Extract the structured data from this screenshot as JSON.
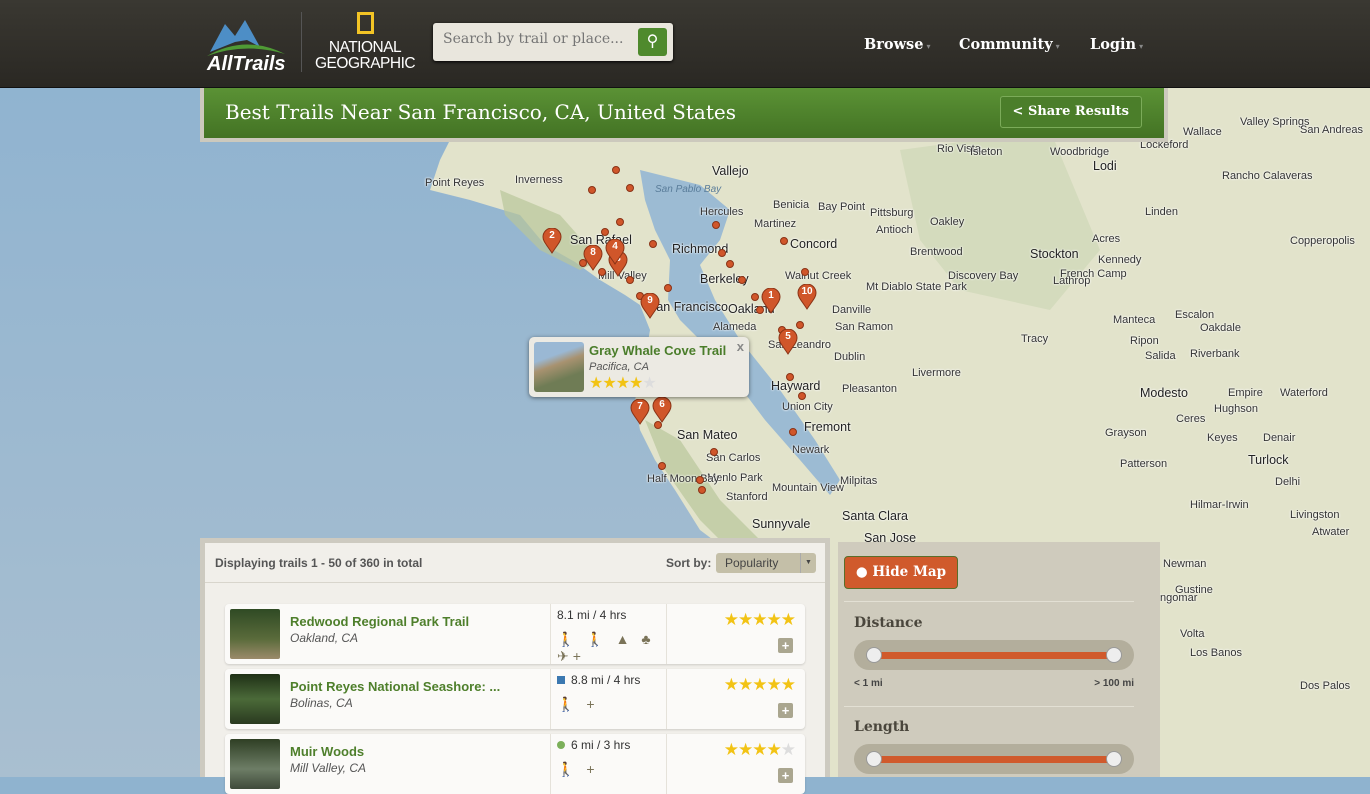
{
  "header": {
    "brand": "AllTrails",
    "partner": "NATIONAL GEOGRAPHIC",
    "search_placeholder": "Search by trail or place...",
    "nav": [
      "Browse",
      "Community",
      "Login"
    ]
  },
  "title": {
    "text": "Best Trails Near San Francisco, CA, United States",
    "share": "Share Results"
  },
  "map": {
    "labels": [
      "Point Reyes",
      "Inverness",
      "Vallejo",
      "San Pablo Bay",
      "Hercules",
      "Benicia",
      "Martinez",
      "Bay Point",
      "Pittsburg",
      "Antioch",
      "Oakley",
      "Brentwood",
      "Concord",
      "Richmond",
      "San Rafael",
      "Mill Valley",
      "Berkeley",
      "Walnut Creek",
      "Oakland",
      "San Francisco",
      "Alameda",
      "Danville",
      "San Ramon",
      "San Leandro",
      "Dublin",
      "Pleasanton",
      "Hayward",
      "Union City",
      "Fremont",
      "Livermore",
      "Tracy",
      "Stockton",
      "Lodi",
      "Manteca",
      "Modesto",
      "San Mateo",
      "San Carlos",
      "Menlo Park",
      "Half Moon Bay",
      "Stanford",
      "Mountain View",
      "Milpitas",
      "Santa Clara",
      "Sunnyvale",
      "San Jose",
      "Newark",
      "Turlock",
      "Los Banos",
      "Patterson",
      "Ceres",
      "Rio Vista",
      "Discovery Bay",
      "Ripon",
      "Salida",
      "Riverbank",
      "Oakdale",
      "Escalon",
      "Keyes",
      "Denair",
      "Hughson",
      "Empire",
      "Waterford",
      "Newman",
      "Gustine",
      "Delhi",
      "Hilmar-Irwin",
      "Livingston",
      "Atwater",
      "Ingomar",
      "Volta",
      "Dos Palos",
      "Lathrop",
      "French Camp",
      "Mt Diablo State Park",
      "Grayson",
      "Lockeford",
      "Woodbridge",
      "Kennedy",
      "Linden",
      "Rancho Calaveras",
      "Copperopolis",
      "Acres",
      "Isleton",
      "Wallace",
      "Valley Springs",
      "San Andreas"
    ],
    "markers": [
      "1",
      "2",
      "3",
      "4",
      "5",
      "6",
      "7",
      "8",
      "9",
      "10"
    ],
    "popup": {
      "name": "Gray Whale Cove Trail",
      "location": "Pacifica, CA",
      "rating": 4,
      "close": "x"
    }
  },
  "list": {
    "count_text": "Displaying trails 1 - 50 of 360 in total",
    "sort_label": "Sort by:",
    "sort_value": "Popularity",
    "trails": [
      {
        "name": "Redwood Regional Park Trail",
        "location": "Oakland, CA",
        "stats": "8.1 mi / 4 hrs",
        "difficulty": "",
        "activities": "🚶 🚶 ▲ ♣ ✈+",
        "rating": 4.5
      },
      {
        "name": "Point Reyes National Seashore: ...",
        "location": "Bolinas, CA",
        "stats": "8.8 mi / 4 hrs",
        "difficulty": "blue-square",
        "activities": "🚶 +",
        "rating": 4.5
      },
      {
        "name": "Muir Woods",
        "location": "Mill Valley, CA",
        "stats": "6 mi / 3 hrs",
        "difficulty": "green-circle",
        "activities": "🚶 +",
        "rating": 4
      }
    ]
  },
  "filters": {
    "hide_map": "Hide Map",
    "distance": {
      "label": "Distance",
      "min": "< 1 mi",
      "max": "> 100 mi"
    },
    "length": {
      "label": "Length"
    }
  },
  "colors": {
    "accent_green": "#4f8a2d",
    "accent_orange": "#d05a2c"
  }
}
